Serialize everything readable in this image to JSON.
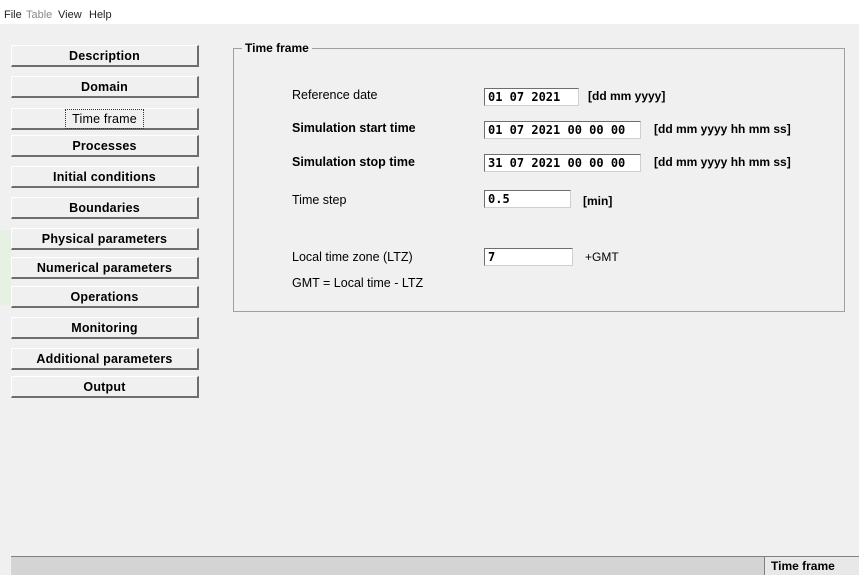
{
  "menu": {
    "file": "File",
    "table": "Table",
    "view": "View",
    "help": "Help"
  },
  "nav": {
    "items": [
      {
        "label": "Description"
      },
      {
        "label": "Domain"
      },
      {
        "label": "Time frame",
        "active": true
      },
      {
        "label": "Processes"
      },
      {
        "label": "Initial conditions"
      },
      {
        "label": "Boundaries"
      },
      {
        "label": "Physical parameters"
      },
      {
        "label": "Numerical parameters"
      },
      {
        "label": "Operations"
      },
      {
        "label": "Monitoring"
      },
      {
        "label": "Additional parameters"
      },
      {
        "label": "Output"
      }
    ]
  },
  "time_frame": {
    "group_title": "Time frame",
    "reference_date": {
      "label": "Reference date",
      "value": "01 07 2021",
      "unit": "[dd mm yyyy]"
    },
    "start_time": {
      "label": "Simulation start time",
      "value": "01 07 2021 00 00 00",
      "unit": "[dd mm yyyy hh mm ss]"
    },
    "stop_time": {
      "label": "Simulation stop time",
      "value": "31 07 2021 00 00 00",
      "unit": "[dd mm yyyy hh mm ss]"
    },
    "time_step": {
      "label": "Time step",
      "value": "0.5",
      "unit": "[min]"
    },
    "ltz": {
      "label": "Local time zone (LTZ)",
      "value": "7",
      "unit": "+GMT"
    },
    "gmt_note": "GMT = Local time - LTZ"
  },
  "status": {
    "panel": "Time frame"
  }
}
